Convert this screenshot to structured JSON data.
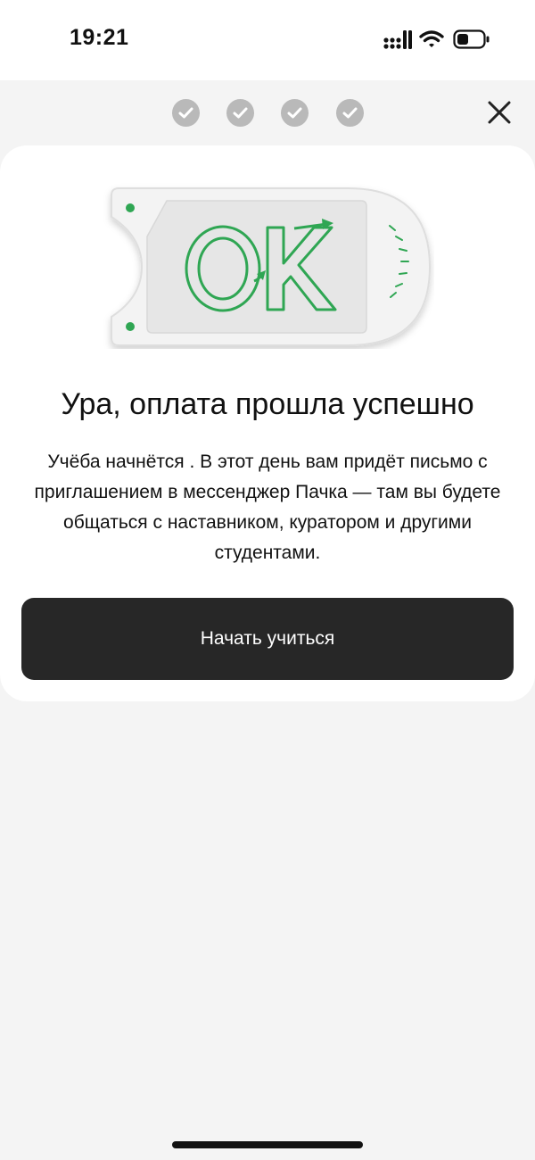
{
  "status_bar": {
    "time": "19:21",
    "icons": [
      "signal-icon",
      "wifi-icon",
      "battery-icon"
    ]
  },
  "progress": {
    "steps_completed": 4,
    "steps_total": 4,
    "step_icon": "check-icon"
  },
  "header": {
    "close_icon": "close-icon"
  },
  "illustration": {
    "text": "OK",
    "accent_color": "#2fa653",
    "card_color": "#f0f0f0"
  },
  "content": {
    "title": "Ура, оплата прошла успешно",
    "description": "Учёба начнётся . В этот день вам придёт письмо с приглашением в мессенджер Пачка — там вы будете общаться с наставником, куратором и другими студентами."
  },
  "actions": {
    "start_label": "Начать учиться"
  },
  "colors": {
    "background": "#f4f4f4",
    "card": "#ffffff",
    "button": "#272727",
    "step": "#b9b9b9"
  }
}
